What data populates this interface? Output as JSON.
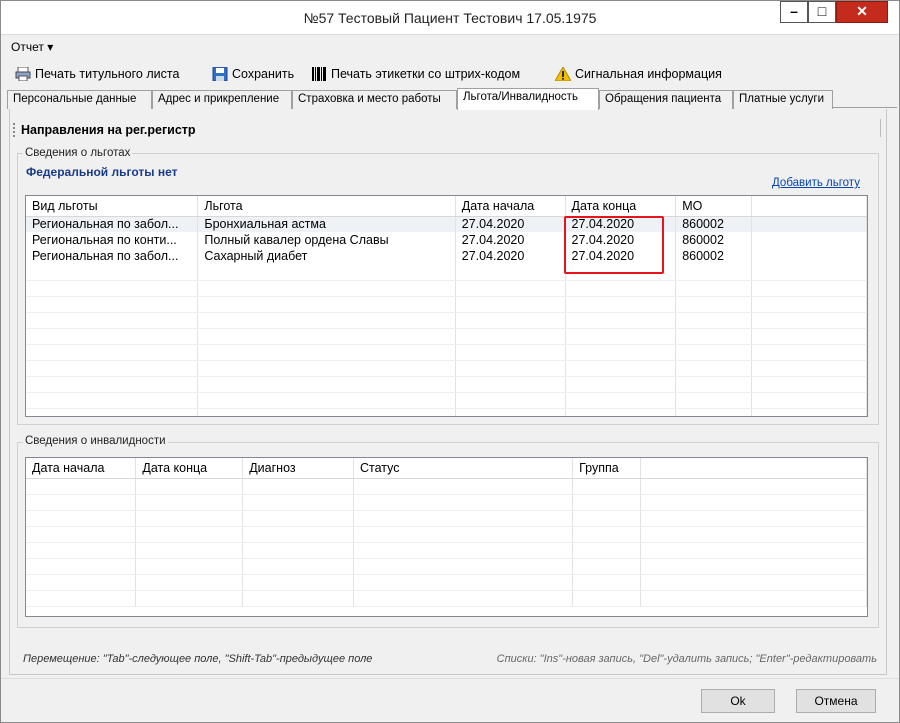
{
  "window": {
    "title": "№57 Тестовый Пациент Тестович 17.05.1975"
  },
  "menu": {
    "report": "Отчет ▾"
  },
  "toolbar": {
    "print_title": "Печать титульного листа",
    "save": "Сохранить",
    "print_barcode": "Печать этикетки со штрих-кодом",
    "signal_info": "Сигнальная информация"
  },
  "tabs": [
    {
      "label": "Персональные данные"
    },
    {
      "label": "Адрес и прикрепление"
    },
    {
      "label": "Страховка и место работы"
    },
    {
      "label": "Льгота/Инвалидность"
    },
    {
      "label": "Обращения пациента"
    },
    {
      "label": "Платные услуги"
    }
  ],
  "subtoolbar": {
    "referrals": "Направления на рег.регистр"
  },
  "benefits": {
    "group_title": "Сведения о льготах",
    "federal_note": "Федеральной льготы нет",
    "add_link": "Добавить льготу",
    "columns": [
      "Вид льготы",
      "Льгота",
      "Дата начала",
      "Дата конца",
      "МО"
    ],
    "rows": [
      [
        "Региональная по забол...",
        "Бронхиальная астма",
        "27.04.2020",
        "27.04.2020",
        "860002"
      ],
      [
        "Региональная по конти...",
        "Полный кавалер ордена Славы",
        "27.04.2020",
        "27.04.2020",
        "860002"
      ],
      [
        "Региональная по забол...",
        "Сахарный диабет",
        "27.04.2020",
        "27.04.2020",
        "860002"
      ]
    ]
  },
  "disability": {
    "group_title": "Сведения о инвалидности",
    "columns": [
      "Дата начала",
      "Дата конца",
      "Диагноз",
      "Статус",
      "Группа"
    ]
  },
  "hints": {
    "left": "Перемещение: \"Tab\"-следующее поле, \"Shift-Tab\"-предыдущее поле",
    "right": "Списки: \"Ins\"-новая запись, \"Del\"-удалить запись; \"Enter\"-редактировать"
  },
  "dialog": {
    "ok": "Ok",
    "cancel": "Отмена"
  },
  "colors": {
    "highlight": "#e8141c",
    "close_button": "#c42b1c",
    "link": "#0645ad"
  }
}
